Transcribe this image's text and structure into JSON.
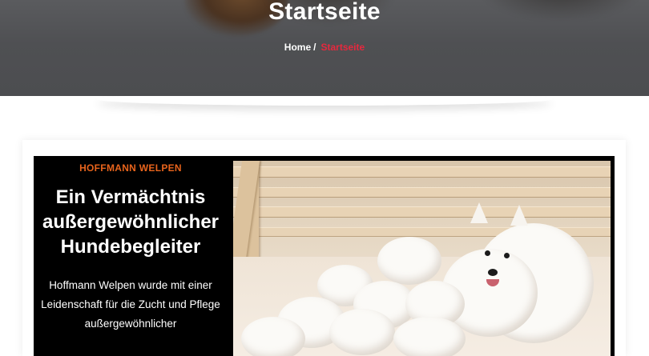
{
  "hero": {
    "title": "Startseite",
    "breadcrumb": {
      "home": "Home",
      "separator": "/",
      "current": "Startseite"
    }
  },
  "intro": {
    "eyebrow": "HOFFMANN WELPEN",
    "headline": "Ein Vermächtnis außergewöhnlicher Hundebegleiter",
    "body": "Hoffmann Welpen wurde mit einer Leidenschaft für die Zucht und Pflege außergewöhnlicher"
  },
  "colors": {
    "accent_orange": "#e8641c",
    "accent_red": "#e7283e",
    "hero_bg": "#4f5053",
    "panel_bg": "#000000"
  }
}
